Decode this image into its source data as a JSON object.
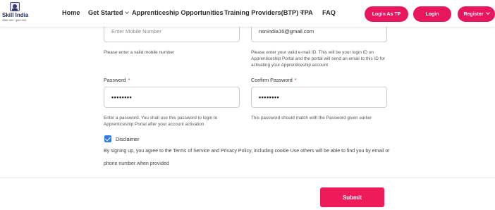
{
  "header": {
    "logo": {
      "title": "Skill India",
      "subtitle": "कौशल भारत - कुशल भारत"
    },
    "nav": {
      "home": "Home",
      "get_started": "Get Started",
      "apprenticeship_opportunities": "Apprenticeship Opportunities",
      "training_providers": "Training Providers(BTP)",
      "tpa": "TPA",
      "faq": "FAQ"
    },
    "buttons": {
      "login_as_tp": "Login As TP",
      "login": "Login",
      "register": "Register"
    },
    "accent_color": "#e8175d"
  },
  "form": {
    "mobile": {
      "placeholder": "Enter Mobile Number",
      "help": "Please enter a valid mobile number"
    },
    "email": {
      "value": "nsnindia16@gmail.com",
      "help": "Please enter your valid e-mail ID. This will be your login ID on Apprenticeship Portal and the portal will send an email to this ID for activating your Apprenticeship account"
    },
    "password": {
      "label": "Password",
      "required_mark": "*",
      "value": "••••••••",
      "help": "Enter a password. You shall use this password to login to Apprenticeship Portal after your account activation"
    },
    "confirm_password": {
      "label": "Confirm Password",
      "required_mark": "*",
      "value": "••••••••",
      "help": "This password should match with the Password given earlier"
    },
    "disclaimer": {
      "checked": true,
      "label": "Disclaimer",
      "text": "By signing up, you agree to the Terms of Service and Privacy Policy, including cookie Use others will be able to find you by email or phone number when provided"
    },
    "submit_label": "Submit"
  }
}
